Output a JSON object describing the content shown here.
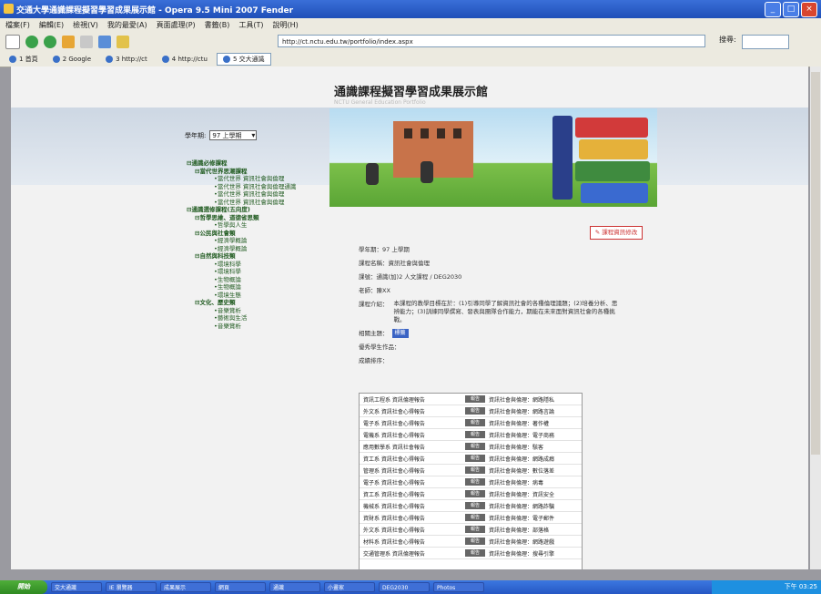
{
  "window": {
    "title": "交通大學通識課程擬習學習成果展示館 - Opera 9.5 Mini 2007 Fender"
  },
  "menu": [
    "檔案(F)",
    "編輯(E)",
    "檢視(V)",
    "我的最愛(A)",
    "頁面處理(P)",
    "書籤(B)",
    "工具(T)",
    "說明(H)"
  ],
  "toolbar": {
    "address": "http://ct.nctu.edu.tw/portfolio/index.aspx",
    "zoom_label": "搜尋:"
  },
  "tabs": [
    "1 首頁",
    "2 Google",
    "3 http://ct",
    "4 http://ctu",
    "5 交大通識"
  ],
  "site": {
    "title": "通識課程擬習學習成果展示館",
    "subtitle": "NCTU General Education Portfolio"
  },
  "sidebar": {
    "semester_label": "學年期:",
    "semester_value": "97 上學期",
    "tree": [
      {
        "level": "l0",
        "text": "⊟通識必修課程"
      },
      {
        "level": "l1",
        "text": "⊟當代世界思潮課程"
      },
      {
        "level": "l3",
        "text": "•當代世界 資訊社會與倫理"
      },
      {
        "level": "l3",
        "text": "•當代世界 資訊社會與倫理通識"
      },
      {
        "level": "l3",
        "text": "•當代世界 資訊社會與倫理"
      },
      {
        "level": "l3",
        "text": "•當代世界 資訊社會與倫理"
      },
      {
        "level": "l0",
        "text": "⊟通識選修課程(五向度)"
      },
      {
        "level": "l1",
        "text": "⊟哲學思維、道德省思類"
      },
      {
        "level": "l3",
        "text": "•哲學與人生"
      },
      {
        "level": "l1",
        "text": "⊟公民與社會類"
      },
      {
        "level": "l3",
        "text": "•經濟學概論"
      },
      {
        "level": "l3",
        "text": "•經濟學概論"
      },
      {
        "level": "l1",
        "text": "⊟自然與科技類"
      },
      {
        "level": "l3",
        "text": "•環境科學"
      },
      {
        "level": "l3",
        "text": "•環境科學"
      },
      {
        "level": "l3",
        "text": "•生物概論"
      },
      {
        "level": "l3",
        "text": "•生物概論"
      },
      {
        "level": "l3",
        "text": "•環境生態"
      },
      {
        "level": "l1",
        "text": "⊟文化、歷史類"
      },
      {
        "level": "l3",
        "text": "•音樂賞析"
      },
      {
        "level": "l3",
        "text": "•藝術與生活"
      },
      {
        "level": "l3",
        "text": "•音樂賞析"
      }
    ]
  },
  "main": {
    "edit_button": "✎ 課程資訊修改",
    "semester": "學年期：97 上學期",
    "course_name": "課程名稱：資訊社會與倫理",
    "course_code": "課號：通識(加)2 人文課程 / DEG2030",
    "teacher": "老師：陳XX",
    "desc_label": "課程介紹：",
    "desc": "本課程的教學目標在於：(1)引導同學了解資訊社會的各種倫理議題；(2)培養分析、思辨能力；(3)訓練同學撰寫、發表與團隊合作能力，期能在未來面對資訊社會的各種挑戰。",
    "tag_label": "相關主題：",
    "tag_value": "標籤",
    "works_label": "優秀學生作品：",
    "list_label": "成績排序：",
    "rows": [
      {
        "name": "資訊工程系 資訊倫理報告",
        "badge": "報告",
        "title": "資訊社會與倫理：網路隱私"
      },
      {
        "name": "外文系 資訊社會心得報告",
        "badge": "報告",
        "title": "資訊社會與倫理：網路言論"
      },
      {
        "name": "電子系 資訊社會心得報告",
        "badge": "報告",
        "title": "資訊社會與倫理：著作權"
      },
      {
        "name": "電機系 資訊社會心得報告",
        "badge": "報告",
        "title": "資訊社會與倫理：電子商務"
      },
      {
        "name": "應用數學系 資訊社會報告",
        "badge": "報告",
        "title": "資訊社會與倫理：駭客"
      },
      {
        "name": "資工系 資訊社會心得報告",
        "badge": "報告",
        "title": "資訊社會與倫理：網路成癮"
      },
      {
        "name": "管理系 資訊社會心得報告",
        "badge": "報告",
        "title": "資訊社會與倫理：數位落差"
      },
      {
        "name": "電子系 資訊社會心得報告",
        "badge": "報告",
        "title": "資訊社會與倫理：病毒"
      },
      {
        "name": "資工系 資訊社會心得報告",
        "badge": "報告",
        "title": "資訊社會與倫理：資訊安全"
      },
      {
        "name": "機械系 資訊社會心得報告",
        "badge": "報告",
        "title": "資訊社會與倫理：網路詐騙"
      },
      {
        "name": "資財系 資訊社會心得報告",
        "badge": "報告",
        "title": "資訊社會與倫理：電子郵件"
      },
      {
        "name": "外文系 資訊社會心得報告",
        "badge": "報告",
        "title": "資訊社會與倫理：部落格"
      },
      {
        "name": "材料系 資訊社會心得報告",
        "badge": "報告",
        "title": "資訊社會與倫理：網路遊戲"
      },
      {
        "name": "交通管理系 資訊倫理報告",
        "badge": "報告",
        "title": "資訊社會與倫理：搜尋引擎"
      }
    ]
  },
  "taskbar": {
    "start": "開始",
    "items": [
      "交大通識",
      "IE 瀏覽器",
      "成果展示",
      "網頁",
      "通識",
      "小畫家",
      "DEG2030",
      "Photos"
    ],
    "clock": "下午 03:25"
  }
}
